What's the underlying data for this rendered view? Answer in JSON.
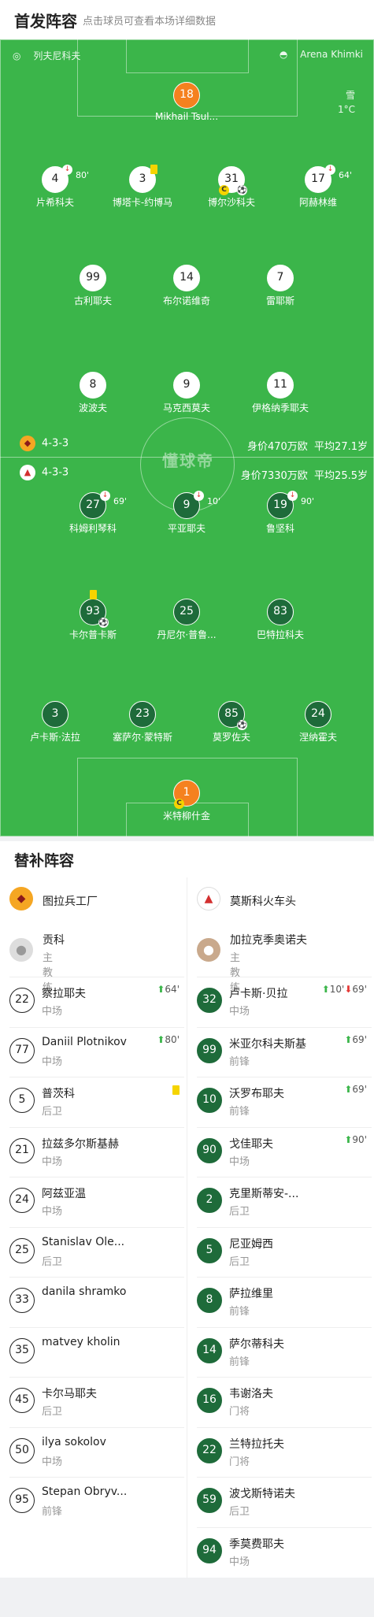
{
  "header": {
    "title": "首发阵容",
    "subtitle": "点击球员可查看本场详细数据"
  },
  "pitch": {
    "referee": "列夫尼科夫",
    "stadium": "Arena Khimki",
    "weather": "雪",
    "temperature": "1°C",
    "watermark": "懂球帝",
    "home": {
      "formation": "4-3-3",
      "value": "身价470万欧",
      "avg_age": "平均27.1岁",
      "players": [
        {
          "num": "18",
          "name": "Mikhail Tsul...",
          "role": "gk"
        },
        {
          "num": "4",
          "name": "片希科夫",
          "sub_out": "80'"
        },
        {
          "num": "3",
          "name": "博塔卡-约博马",
          "yellow": true
        },
        {
          "num": "31",
          "name": "博尔沙科夫",
          "captain": "C",
          "goal": true
        },
        {
          "num": "17",
          "name": "阿赫林维",
          "sub_out": "64'"
        },
        {
          "num": "99",
          "name": "古利耶夫"
        },
        {
          "num": "14",
          "name": "布尔诺维奇"
        },
        {
          "num": "7",
          "name": "雷耶斯"
        },
        {
          "num": "8",
          "name": "波波夫"
        },
        {
          "num": "9",
          "name": "马克西莫夫"
        },
        {
          "num": "11",
          "name": "伊格纳季耶夫"
        }
      ]
    },
    "away": {
      "formation": "4-3-3",
      "value": "身价7330万欧",
      "avg_age": "平均25.5岁",
      "players": [
        {
          "num": "27",
          "name": "科姆利琴科",
          "sub_out": "69'"
        },
        {
          "num": "9",
          "name": "平亚耶夫",
          "sub_out": "10'"
        },
        {
          "num": "19",
          "name": "鲁坚科",
          "sub_out": "90'"
        },
        {
          "num": "93",
          "name": "卡尔普卡斯",
          "yellow": true,
          "goal": true
        },
        {
          "num": "25",
          "name": "丹尼尔·普鲁..."
        },
        {
          "num": "83",
          "name": "巴特拉科夫"
        },
        {
          "num": "3",
          "name": "卢卡斯·法拉"
        },
        {
          "num": "23",
          "name": "塞萨尔·蒙特斯"
        },
        {
          "num": "85",
          "name": "莫罗佐夫",
          "goal": true
        },
        {
          "num": "24",
          "name": "涅纳霍夫"
        },
        {
          "num": "1",
          "name": "米特柳什金",
          "role": "gk",
          "captain": "C"
        }
      ]
    }
  },
  "subs": {
    "title": "替补阵容",
    "home": {
      "team": "图拉兵工厂",
      "coach": "贡科",
      "coach_role": "主教练",
      "players": [
        {
          "num": "22",
          "name": "察拉耶夫",
          "pos": "中场",
          "ev": "64'",
          "ev_type": "in"
        },
        {
          "num": "77",
          "name": "Daniil Plotnikov",
          "pos": "中场",
          "ev": "80'",
          "ev_type": "in"
        },
        {
          "num": "5",
          "name": "普茨科",
          "pos": "后卫",
          "ev_type": "yellow"
        },
        {
          "num": "21",
          "name": "拉兹多尔斯基赫",
          "pos": "中场"
        },
        {
          "num": "24",
          "name": "阿兹亚温",
          "pos": "中场"
        },
        {
          "num": "25",
          "name": "Stanislav Ole...",
          "pos": "后卫"
        },
        {
          "num": "33",
          "name": "danila shramko",
          "pos": ""
        },
        {
          "num": "35",
          "name": "matvey kholin",
          "pos": ""
        },
        {
          "num": "45",
          "name": "卡尔马耶夫",
          "pos": "后卫"
        },
        {
          "num": "50",
          "name": "ilya sokolov",
          "pos": "中场"
        },
        {
          "num": "95",
          "name": "Stepan Obryv...",
          "pos": "前锋"
        }
      ]
    },
    "away": {
      "team": "莫斯科火车头",
      "coach": "加拉克季奥诺夫",
      "coach_role": "主教练",
      "players": [
        {
          "num": "32",
          "name": "卢卡斯·贝拉",
          "pos": "中场",
          "ev": "10'",
          "ev2": "69'",
          "ev_type": "in-out"
        },
        {
          "num": "99",
          "name": "米亚尔科夫斯基",
          "pos": "前锋",
          "ev": "69'",
          "ev_type": "in"
        },
        {
          "num": "10",
          "name": "沃罗布耶夫",
          "pos": "前锋",
          "ev": "69'",
          "ev_type": "in"
        },
        {
          "num": "90",
          "name": "戈佳耶夫",
          "pos": "中场",
          "ev": "90'",
          "ev_type": "in"
        },
        {
          "num": "2",
          "name": "克里斯蒂安-...",
          "pos": "后卫"
        },
        {
          "num": "5",
          "name": "尼亚姆西",
          "pos": "后卫"
        },
        {
          "num": "8",
          "name": "萨拉维里",
          "pos": "前锋"
        },
        {
          "num": "14",
          "name": "萨尔蒂科夫",
          "pos": "前锋"
        },
        {
          "num": "16",
          "name": "韦谢洛夫",
          "pos": "门将"
        },
        {
          "num": "22",
          "name": "兰特拉托夫",
          "pos": "门将"
        },
        {
          "num": "59",
          "name": "波戈斯特诺夫",
          "pos": "后卫"
        },
        {
          "num": "94",
          "name": "季莫费耶夫",
          "pos": "中场"
        }
      ]
    }
  },
  "colors": {
    "pitch": "#3bb54a",
    "away_circle": "#1e6b3a",
    "gk": "#f5811f",
    "yellow": "#f5d400",
    "sub_out": "#e53935"
  }
}
